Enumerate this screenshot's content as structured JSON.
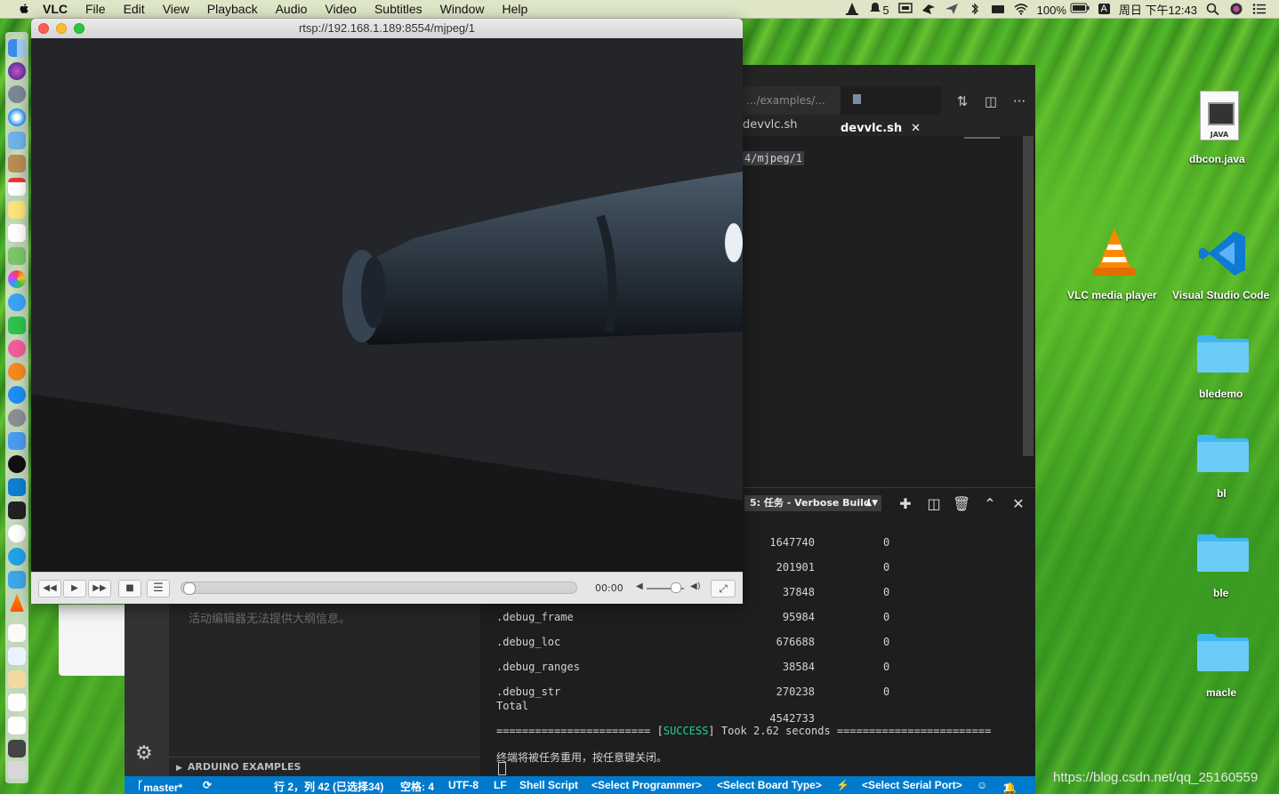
{
  "menubar": {
    "app_name": "VLC",
    "items": [
      "File",
      "Edit",
      "View",
      "Playback",
      "Audio",
      "Video",
      "Subtitles",
      "Window",
      "Help"
    ],
    "notification_count": "5",
    "battery": "100%",
    "input_method": "A",
    "clock": "周日 下午12:43"
  },
  "vlc": {
    "title": "rtsp://192.168.1.189:8554/mjpeg/1",
    "time": "00:00",
    "progress": 0.0,
    "volume": 0.75
  },
  "vscode": {
    "tab_prev": ".../examples/...",
    "tab_active": "devvlc.sh",
    "breadcrumb": "devvlc.sh",
    "code_fragment": "4/mjpeg/1",
    "terminal_select": "5: 任务 - Verbose Build",
    "outline_message": "活动编辑器无法提供大纲信息。",
    "arduino_header": "ARDUINO EXAMPLES",
    "terminal_rows": [
      {
        "name": "",
        "size": "1647740",
        "addr": "0"
      },
      {
        "name": "",
        "size": "201901",
        "addr": "0"
      },
      {
        "name": "",
        "size": "37848",
        "addr": "0"
      },
      {
        "name": ".debug_frame",
        "size": "95984",
        "addr": "0"
      },
      {
        "name": ".debug_loc",
        "size": "676688",
        "addr": "0"
      },
      {
        "name": ".debug_ranges",
        "size": "38584",
        "addr": "0"
      },
      {
        "name": ".debug_str",
        "size": "270238",
        "addr": "0"
      },
      {
        "name": "Total",
        "size": "",
        "addr": ""
      }
    ],
    "total_value": "4542733",
    "success_line": {
      "prefix": "======================== [",
      "word": "SUCCESS",
      "suffix": "] Took 2.62 seconds ========================"
    },
    "reuse_message": "终端将被任务重用，按任意键关闭。",
    "statusbar": {
      "branch": "master*",
      "position": "行 2，列 42 (已选择34)",
      "spaces": "空格: 4",
      "encoding": "UTF-8",
      "eol": "LF",
      "language": "Shell Script",
      "programmer": "<Select Programmer>",
      "board": "<Select Board Type>",
      "serial": "<Select Serial Port>",
      "notifications": "1"
    }
  },
  "desktop": {
    "items": [
      {
        "label": "dbcon.java",
        "badge": "JAVA"
      },
      {
        "label": "VLC media player"
      },
      {
        "label": "Visual Studio Code"
      },
      {
        "label": "bledemo"
      },
      {
        "label": "bl"
      },
      {
        "label": "ble"
      },
      {
        "label": "macle"
      }
    ],
    "watermark": "https://blog.csdn.net/qq_25160559"
  },
  "colors": {
    "vscode_status": "#007acc",
    "terminal_success": "#23d18b",
    "folder": "#3fb6f0"
  }
}
